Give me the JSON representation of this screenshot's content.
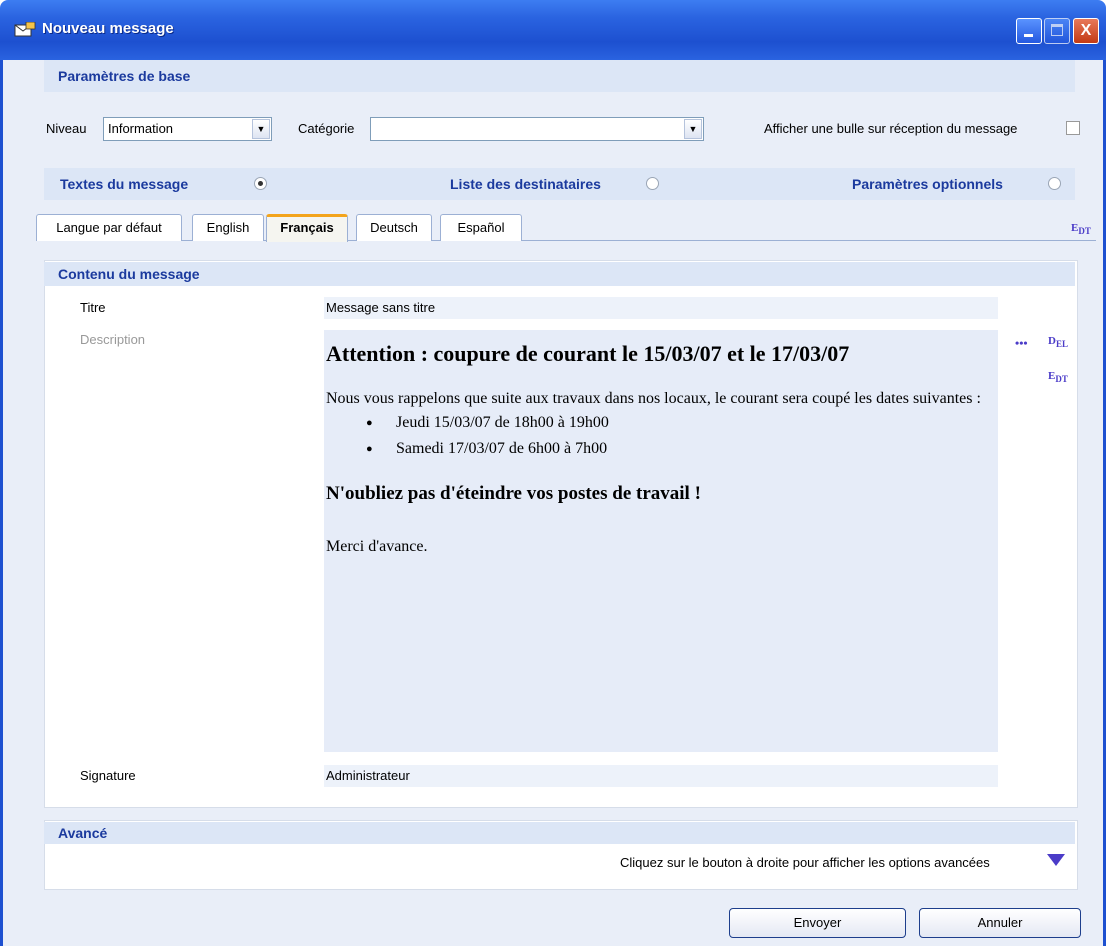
{
  "window": {
    "title": "Nouveau message",
    "controls": {
      "minimize": "minimize",
      "maximize": "maximize",
      "close": "X"
    }
  },
  "basic": {
    "header": "Paramètres de base",
    "level_label": "Niveau",
    "level_value": "Information",
    "category_label": "Catégorie",
    "category_value": "",
    "bubble_label": "Afficher une bulle sur réception du message",
    "bubble_checked": false
  },
  "sections": {
    "texts": "Textes du message",
    "recipients": "Liste des destinataires",
    "optional": "Paramètres optionnels",
    "selected": "texts"
  },
  "tabs": [
    {
      "label": "Langue par défaut",
      "active": false
    },
    {
      "label": "English",
      "active": false
    },
    {
      "label": "Français",
      "active": true
    },
    {
      "label": "Deutsch",
      "active": false
    },
    {
      "label": "Español",
      "active": false
    }
  ],
  "content": {
    "header": "Contenu du message",
    "title_label": "Titre",
    "title_value": "Message sans titre",
    "desc_label": "Description",
    "desc": {
      "heading": "Attention : coupure de courant le 15/03/07 et le 17/03/07",
      "intro": "Nous vous rappelons que suite aux travaux dans nos locaux, le courant sera coupé les dates suivantes :",
      "items": [
        "Jeudi 15/03/07 de 18h00 à 19h00",
        "Samedi 17/03/07 de 6h00 à 7h00"
      ],
      "emphasis": "N'oubliez pas d'éteindre vos postes de travail !",
      "closing": "Merci d'avance."
    },
    "ellipsis": "•••",
    "signature_label": "Signature",
    "signature_value": "Administrateur"
  },
  "advanced": {
    "header": "Avancé",
    "note": "Cliquez sur le bouton à droite pour afficher les options avancées"
  },
  "buttons": {
    "send": "Envoyer",
    "cancel": "Annuler"
  },
  "icons": {
    "edt": "E D T",
    "del": "D E L"
  },
  "colors": {
    "accent": "#1b3a9e",
    "icon": "#4b3cc8",
    "titlebar": "#2a63e0"
  }
}
